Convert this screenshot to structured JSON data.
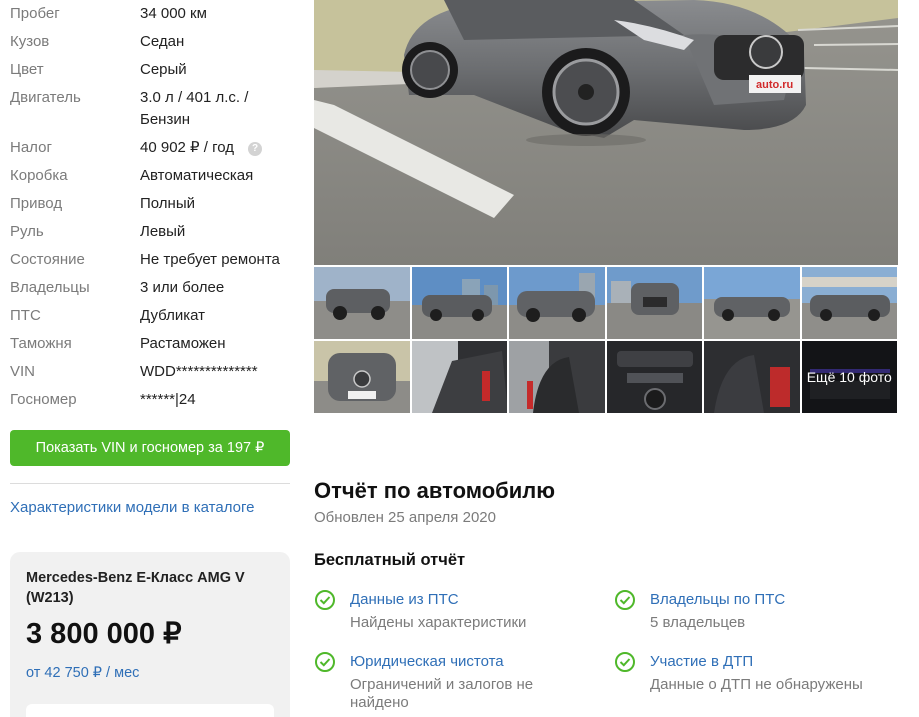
{
  "specs": [
    {
      "label": "Пробег",
      "value": "34 000 км"
    },
    {
      "label": "Кузов",
      "value": "Седан"
    },
    {
      "label": "Цвет",
      "value": "Серый"
    },
    {
      "label": "Двигатель",
      "value": "3.0 л / 401 л.с. / Бензин"
    },
    {
      "label": "Налог",
      "value": "40 902 ₽ / год"
    },
    {
      "label": "Коробка",
      "value": "Автоматическая"
    },
    {
      "label": "Привод",
      "value": "Полный"
    },
    {
      "label": "Руль",
      "value": "Левый"
    },
    {
      "label": "Состояние",
      "value": "Не требует ремонта"
    },
    {
      "label": "Владельцы",
      "value": "3 или более"
    },
    {
      "label": "ПТС",
      "value": "Дубликат"
    },
    {
      "label": "Таможня",
      "value": "Растаможен"
    },
    {
      "label": "VIN",
      "value": "WDD**************"
    },
    {
      "label": "Госномер",
      "value": "******|24"
    }
  ],
  "tax_help_icon": "?",
  "vin_button": "Показать VIN и госномер за 197 ₽",
  "catalog_link": "Характеристики модели в каталоге",
  "price_card": {
    "model": "Mercedes-Benz E-Класс AMG V (W213)",
    "price": "3 800 000 ₽",
    "credit": "от 42 750 ₽ / мес"
  },
  "gallery": {
    "plate_text": "auto.ru",
    "more_photos": "Ещё 10 фото"
  },
  "report": {
    "title": "Отчёт по автомобилю",
    "updated": "Обновлен 25 апреля 2020",
    "free_title": "Бесплатный отчёт",
    "items": [
      {
        "link": "Данные из ПТС",
        "desc": "Найдены характеристики"
      },
      {
        "link": "Владельцы по ПТС",
        "desc": "5 владельцев"
      },
      {
        "link": "Юридическая чистота",
        "desc": "Ограничений и залогов не найдено"
      },
      {
        "link": "Участие в ДТП",
        "desc": "Данные о ДТП не обнаружены"
      }
    ]
  },
  "colors": {
    "accent_green": "#4fb82a",
    "link_blue": "#2f6fb7",
    "muted_gray": "#7b7b7b"
  }
}
